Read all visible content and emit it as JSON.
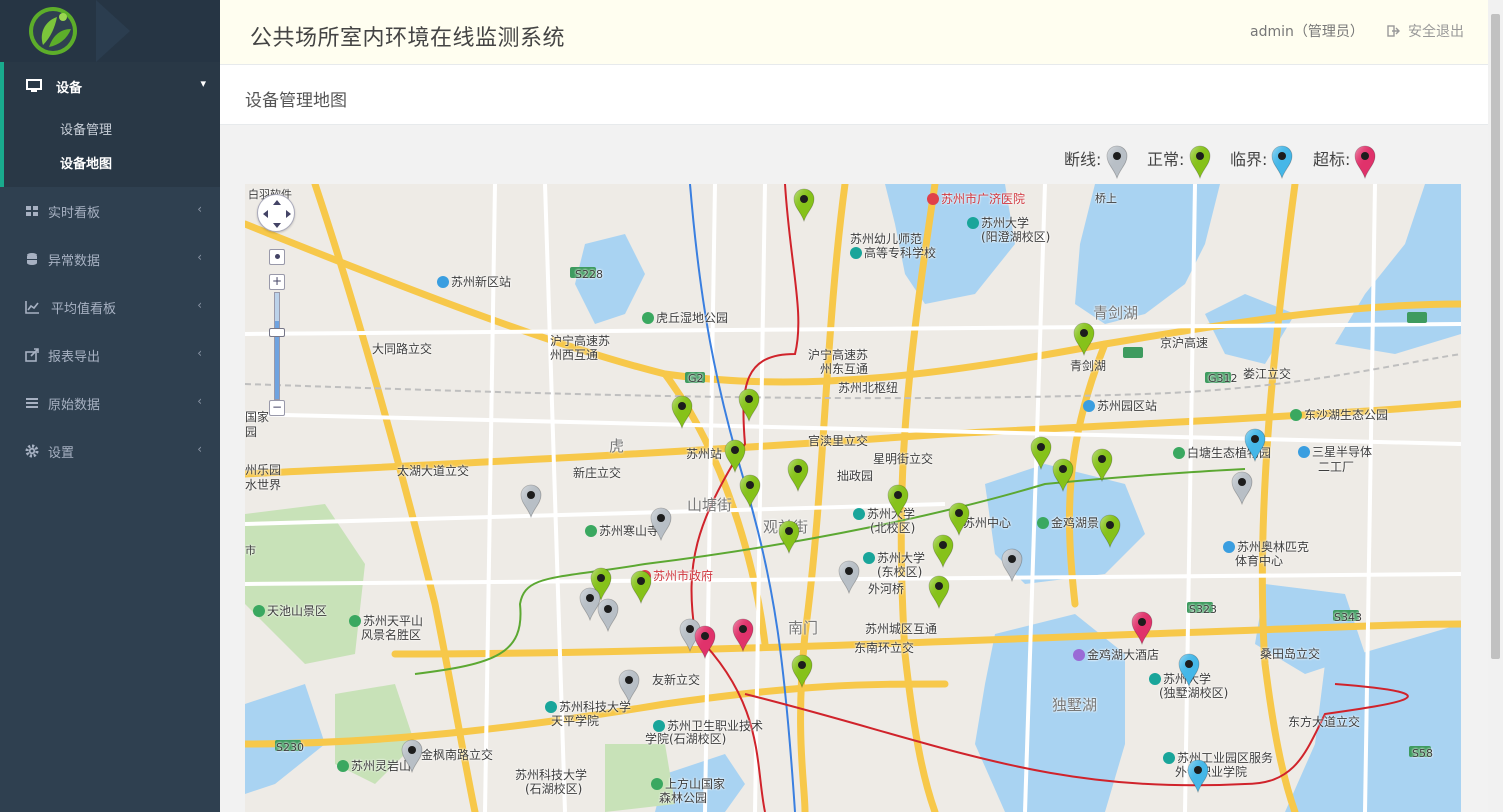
{
  "app": {
    "title": "公共场所室内环境在线监测系统",
    "user": "admin（管理员）",
    "logout": "安全退出"
  },
  "page": {
    "title": "设备管理地图"
  },
  "sidebar": {
    "open_section": {
      "label": "设备",
      "icon": "monitor-icon",
      "children": [
        {
          "label": "设备管理"
        },
        {
          "label": "设备地图"
        }
      ]
    },
    "items": [
      {
        "label": "实时看板",
        "icon": "grid-icon"
      },
      {
        "label": "异常数据",
        "icon": "database-icon"
      },
      {
        "label": "平均值看板",
        "icon": "line-chart-icon"
      },
      {
        "label": "报表导出",
        "icon": "export-icon"
      },
      {
        "label": "原始数据",
        "icon": "list-icon"
      },
      {
        "label": "设置",
        "icon": "gear-icon"
      }
    ]
  },
  "legend": [
    {
      "label": "断线:",
      "color": "#b8bfc6"
    },
    {
      "label": "正常:",
      "color": "#86c21a"
    },
    {
      "label": "临界:",
      "color": "#45b7e8"
    },
    {
      "label": "超标:",
      "color": "#e0326b"
    }
  ],
  "map": {
    "labels": [
      {
        "t": "苏州市广济医院",
        "cls": "red",
        "poi": "#e0404a"
      },
      {
        "t": "苏州大学",
        "cls": "",
        "poi": "#19a59a"
      },
      {
        "t": "(阳澄湖校区)",
        "cls": "",
        "poi": ""
      },
      {
        "t": "苏州幼儿师范",
        "cls": "",
        "poi": ""
      },
      {
        "t": "高等专科学校",
        "cls": "",
        "poi": "#19a59a"
      },
      {
        "t": "苏州新区站",
        "cls": "",
        "poi": "#3a9ee0"
      },
      {
        "t": "S228",
        "cls": "small",
        "poi": ""
      },
      {
        "t": "虎丘湿地公园",
        "cls": "",
        "poi": "#3aa860"
      },
      {
        "t": "青剑湖",
        "cls": "dist",
        "poi": ""
      },
      {
        "t": "沪宁高速苏",
        "cls": "",
        "poi": ""
      },
      {
        "t": "州东互通",
        "cls": "",
        "poi": ""
      },
      {
        "t": "沪宁高速苏",
        "cls": "",
        "poi": ""
      },
      {
        "t": "州西互通",
        "cls": "",
        "poi": ""
      },
      {
        "t": "大同路立交",
        "cls": "",
        "poi": ""
      },
      {
        "t": "G2",
        "cls": "small",
        "poi": ""
      },
      {
        "t": "苏州北枢纽",
        "cls": "",
        "poi": ""
      },
      {
        "t": "青剑湖",
        "cls": "",
        "poi": ""
      },
      {
        "t": "京沪高速",
        "cls": "",
        "poi": ""
      },
      {
        "t": "G312",
        "cls": "small",
        "poi": ""
      },
      {
        "t": "娄江立交",
        "cls": "",
        "poi": ""
      },
      {
        "t": "苏州园区站",
        "cls": "",
        "poi": "#3a9ee0"
      },
      {
        "t": "东沙湖生态公园",
        "cls": "",
        "poi": "#3aa860"
      },
      {
        "t": "白塘生态植物园",
        "cls": "",
        "poi": "#3aa860"
      },
      {
        "t": "三星半导体",
        "cls": "",
        "poi": "#3a9ee0"
      },
      {
        "t": "二工厂",
        "cls": "",
        "poi": ""
      },
      {
        "t": "官渎里立交",
        "cls": "",
        "poi": ""
      },
      {
        "t": "星明街立交",
        "cls": "",
        "poi": ""
      },
      {
        "t": "苏州站",
        "cls": "",
        "poi": ""
      },
      {
        "t": "拙政园",
        "cls": "",
        "poi": ""
      },
      {
        "t": "太湖大道立交",
        "cls": "",
        "poi": ""
      },
      {
        "t": "新庄立交",
        "cls": "",
        "poi": ""
      },
      {
        "t": "山塘街",
        "cls": "dist",
        "poi": ""
      },
      {
        "t": "苏州大学",
        "cls": "",
        "poi": "#19a59a"
      },
      {
        "t": "(北校区)",
        "cls": "",
        "poi": ""
      },
      {
        "t": "苏州中心",
        "cls": "",
        "poi": ""
      },
      {
        "t": "金鸡湖景",
        "cls": "",
        "poi": "#3aa860"
      },
      {
        "t": "苏州寒山寺",
        "cls": "",
        "poi": "#3aa860"
      },
      {
        "t": "观前街",
        "cls": "dist",
        "poi": ""
      },
      {
        "t": "苏州大学",
        "cls": "",
        "poi": "#19a59a"
      },
      {
        "t": "(东校区)",
        "cls": "",
        "poi": ""
      },
      {
        "t": "苏州奥林匹克",
        "cls": "",
        "poi": "#3a9ee0"
      },
      {
        "t": "体育中心",
        "cls": "",
        "poi": ""
      },
      {
        "t": "苏州市政府",
        "cls": "red",
        "poi": "#e0404a"
      },
      {
        "t": "外河桥",
        "cls": "",
        "poi": ""
      },
      {
        "t": "天池山景区",
        "cls": "",
        "poi": "#3aa860"
      },
      {
        "t": "苏州天平山",
        "cls": "",
        "poi": "#3aa860"
      },
      {
        "t": "风景名胜区",
        "cls": "",
        "poi": ""
      },
      {
        "t": "S323",
        "cls": "small",
        "poi": ""
      },
      {
        "t": "S343",
        "cls": "small",
        "poi": ""
      },
      {
        "t": "南门",
        "cls": "dist",
        "poi": ""
      },
      {
        "t": "苏州城区互通",
        "cls": "",
        "poi": ""
      },
      {
        "t": "东南环立交",
        "cls": "",
        "poi": ""
      },
      {
        "t": "金鸡湖大酒店",
        "cls": "",
        "poi": "#9a6bd6"
      },
      {
        "t": "桑田岛立交",
        "cls": "",
        "poi": ""
      },
      {
        "t": "苏州大学",
        "cls": "",
        "poi": "#19a59a"
      },
      {
        "t": "(独墅湖校区)",
        "cls": "",
        "poi": ""
      },
      {
        "t": "友新立交",
        "cls": "",
        "poi": ""
      },
      {
        "t": "独墅湖",
        "cls": "dist",
        "poi": ""
      },
      {
        "t": "苏州科技大学",
        "cls": "",
        "poi": "#19a59a"
      },
      {
        "t": "天平学院",
        "cls": "",
        "poi": ""
      },
      {
        "t": "苏州卫生职业技术",
        "cls": "",
        "poi": "#19a59a"
      },
      {
        "t": "学院(石湖校区)",
        "cls": "",
        "poi": ""
      },
      {
        "t": "东方大道立交",
        "cls": "",
        "poi": ""
      },
      {
        "t": "S230",
        "cls": "small",
        "poi": ""
      },
      {
        "t": "金枫南路立交",
        "cls": "",
        "poi": ""
      },
      {
        "t": "苏州工业园区服务",
        "cls": "",
        "poi": "#19a59a"
      },
      {
        "t": "外包职业学院",
        "cls": "",
        "poi": ""
      },
      {
        "t": "苏州灵岩山",
        "cls": "",
        "poi": "#3aa860"
      },
      {
        "t": "苏州科技大学",
        "cls": "",
        "poi": ""
      },
      {
        "t": "(石湖校区)",
        "cls": "",
        "poi": ""
      },
      {
        "t": "上方山国家",
        "cls": "",
        "poi": "#3aa860"
      },
      {
        "t": "森林公园",
        "cls": "",
        "poi": ""
      },
      {
        "t": "S58",
        "cls": "small",
        "poi": ""
      },
      {
        "t": "桥上",
        "cls": "small",
        "poi": ""
      },
      {
        "t": "白羽软件",
        "cls": "small",
        "poi": ""
      },
      {
        "t": "国家",
        "cls": "",
        "poi": ""
      },
      {
        "t": "园",
        "cls": "",
        "poi": ""
      },
      {
        "t": "州乐园",
        "cls": "",
        "poi": ""
      },
      {
        "t": "水世界",
        "cls": "",
        "poi": ""
      },
      {
        "t": "市",
        "cls": "small",
        "poi": ""
      },
      {
        "t": "虎",
        "cls": "dist",
        "poi": ""
      }
    ],
    "pins": [
      {
        "status": "normal"
      },
      {
        "status": "normal"
      },
      {
        "status": "normal"
      },
      {
        "status": "normal"
      },
      {
        "status": "normal"
      },
      {
        "status": "normal"
      },
      {
        "status": "normal"
      },
      {
        "status": "normal"
      },
      {
        "status": "normal"
      },
      {
        "status": "normal"
      },
      {
        "status": "normal"
      },
      {
        "status": "normal"
      },
      {
        "status": "normal"
      },
      {
        "status": "normal"
      },
      {
        "status": "normal"
      },
      {
        "status": "normal"
      },
      {
        "status": "normal"
      },
      {
        "status": "normal"
      },
      {
        "status": "normal"
      },
      {
        "status": "offline"
      },
      {
        "status": "offline"
      },
      {
        "status": "offline"
      },
      {
        "status": "offline"
      },
      {
        "status": "offline"
      },
      {
        "status": "offline"
      },
      {
        "status": "offline"
      },
      {
        "status": "offline"
      },
      {
        "status": "offline"
      },
      {
        "status": "offline"
      },
      {
        "status": "critical"
      },
      {
        "status": "critical"
      },
      {
        "status": "critical"
      },
      {
        "status": "exceed"
      },
      {
        "status": "exceed"
      },
      {
        "status": "exceed"
      }
    ]
  }
}
